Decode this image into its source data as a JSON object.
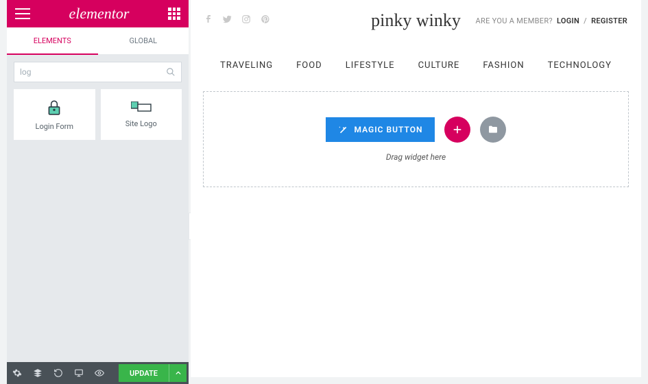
{
  "sidebar": {
    "brand": "elementor",
    "tabs": {
      "elements": "ELEMENTS",
      "global": "GLOBAL"
    },
    "search": {
      "value": "log"
    },
    "widgets": [
      {
        "name": "Login Form",
        "icon": "lock"
      },
      {
        "name": "Site Logo",
        "icon": "logo"
      }
    ],
    "update_label": "UPDATE"
  },
  "preview": {
    "site_title": "pinky winky",
    "member_prompt": "ARE YOU A MEMBER?",
    "login": "LOGIN",
    "sep": "/",
    "register": "REGISTER",
    "nav": [
      "TRAVELING",
      "FOOD",
      "LIFESTYLE",
      "CULTURE",
      "FASHION",
      "TECHNOLOGY"
    ],
    "magic_label": "MAGIC BUTTON",
    "drag_hint": "Drag widget here"
  }
}
